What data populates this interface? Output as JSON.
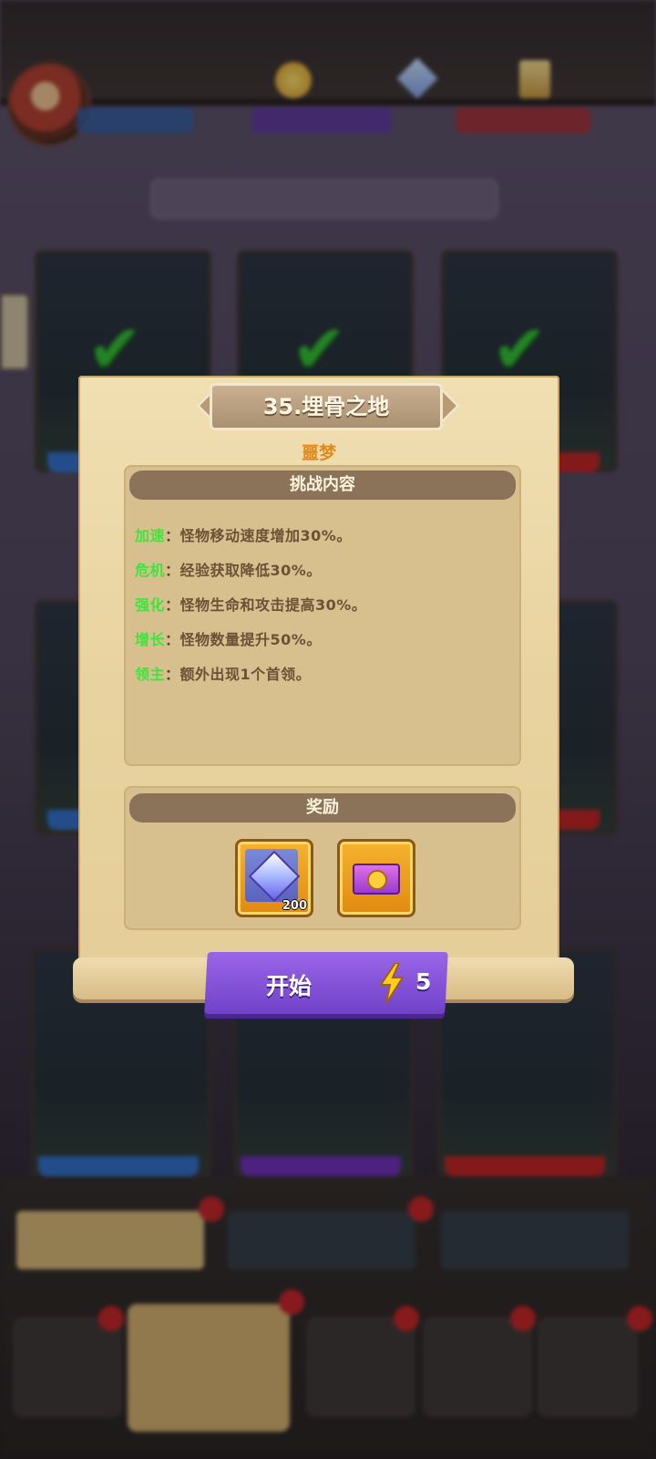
{
  "dialog": {
    "title": "35.埋骨之地",
    "difficulty": "噩梦",
    "challenge_header": "挑战内容",
    "challenges": [
      {
        "tag": "加速",
        "desc": "怪物移动速度增加30%。"
      },
      {
        "tag": "危机",
        "desc": "经验获取降低30%。"
      },
      {
        "tag": "强化",
        "desc": "怪物生命和攻击提高30%。"
      },
      {
        "tag": "增长",
        "desc": "怪物数量提升50%。"
      },
      {
        "tag": "领主",
        "desc": "额外出现1个首领。"
      }
    ],
    "separator": "：",
    "reward_header": "奖励",
    "rewards": [
      {
        "icon": "diamond-gem-icon",
        "quantity": "200"
      },
      {
        "icon": "ticket-icon",
        "quantity": ""
      }
    ],
    "start_label": "开始",
    "energy_cost": "5",
    "energy_icon": "lightning-bolt-icon"
  },
  "colors": {
    "tag_green": "#3ce63c",
    "difficulty_orange": "#e08a1a",
    "start_purple": "#7a4ad4"
  }
}
